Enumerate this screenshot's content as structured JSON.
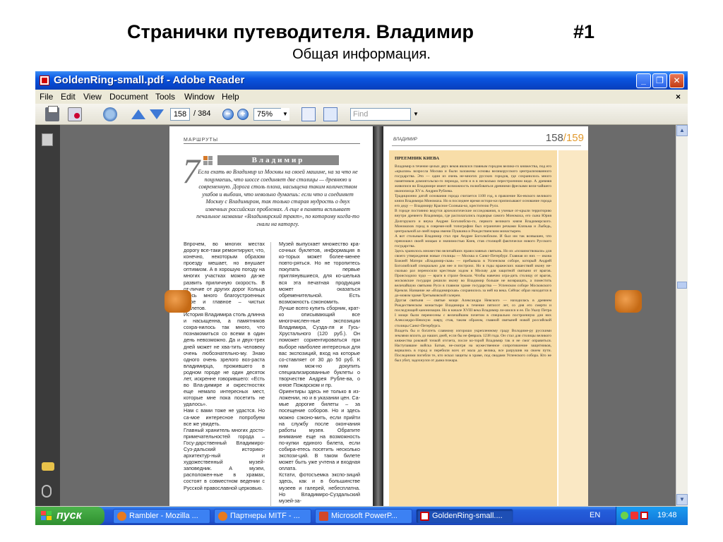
{
  "slide": {
    "title": "Странички путеводителя. Владимир",
    "number": "#1",
    "subtitle": "Общая информация."
  },
  "window": {
    "title": "GoldenRing-small.pdf - Adobe Reader",
    "menu": [
      "File",
      "Edit",
      "View",
      "Document",
      "Tools",
      "Window",
      "Help"
    ],
    "menu_close": "×"
  },
  "toolbar": {
    "page_current": "158",
    "page_total": "/ 384",
    "zoom": "75%",
    "find_placeholder": "Find"
  },
  "left_page": {
    "running_head": "МАРШРУТЫ",
    "chapter_number": "7",
    "chapter_title": "Владимир",
    "intro": "Если ехать во Владимир из Москвы на своей машине, на за что не поцумаешь, что шоссе соединяет две столицы — древнюю и современную. Дорога столь плоха, насыщена таким количеством ухабов и выбоин, что невольно думаешь: если что и соединяет Москву с Владимиром, так только старая мудрость о двух извечных российских проблемах. А еще в памяти всплывает печальное название «Владимирский тракт», по которому когда-то гнали на каторгу.",
    "col1": "Впрочем, во многих местах дорогу все-таки ремонтируют, что, конечно, некоторым образом проезду мешает, но внушает оптимизм. А в хорошую погоду на многих участках можно да-же развить приличную скорость. В от-личие от других дорог Кольца здесь много благоустроенных кафе и главное – чистых туалетов.\n  История Владимира столь длинна и насыщенна, а памятников сохра-нилось так много, что познакомиться со всеми в один день невозможно. Да и двух-трех дней может не хва-тить человеку очень любознательно-му. Знаю одного очень зрелого воз-раста владимирца, прожившего в родном городе не один десяток лет, искренне говорившего: «Есть во Вла-димире и окрестностях еще немало интересных мест, которые мне пока посетить не удалось».\n  Нам с вами тоже не удастся. Но са-мое интересное попробуем все же увидеть.\n  Главный хранитель многих досто-примечательностей города – Госу-дарственный Владимиро-Суз-дальский историко-архитектур-ный и художественный музей-заповедник. А музеи, расположен-ные в храмах, состоят в совместном ведении с Русской православной церковью.",
    "col2": "Музей выпускает множество кра-сочных буклетов, информация в ко-торых может более-менее повто-ряться. Но не торопитесь покупать первые приглянувшиеся, для ко-шелька вся эта печатная продукция может оказаться обременительной. Есть возможность сэкономить.\n  Лучше всего купить сборник, крат-ко описывающий все многочислен-ные экспозиции Владимира, Сузда-ля и Гусь-Хрустального (120 руб.). Он поможет сориентироваться при выборе наиболее интересных для вас экспозиций, вход на которые со-ставляет от 30 до 50 руб. К ним мож-но докупить специализированные буклеты о творчестве Андрея Рубле-ва, о князе Пожарском и пр.\n  Ориентиры здесь не только в из-ложении, но и в указании цен. Са-мые дорогие билеты – за посещение соборов. Но и здесь можно сэконо-мить, если прийти на службу после окончания работы музея. Обратите внимание еще на возможность по-купки единого билета, если собира-етесь посетить несколько экспози-ций. В таком билете может быть уже учтена и входная оплата.\n  Кстати, фотосъемка экспо-зиций здесь, как и в большинстве музеев и галерей, небесплатна. Но Владимиро-Суздальский музей-за-"
  },
  "right_page": {
    "running_head": "ВЛАДИМИР",
    "page_numbers": [
      "158",
      "/159"
    ],
    "box_heading": "ПРЕЕМНИК КИЕВА",
    "box_text": "Владимир в течение целых двух веков являлся главным городом велико-го княжества, под его «крылом» возросла Москва и были заложены основы великорусского централизованного государства. Это — один из очень не-многих русских городов, где сохранилось много памятников домонгольско-го периода, хотя и в в несколько перестроенном виде. А древняя живописи во Владимире имеет возможность полюбоваться древними фресками вели-чайшего иконописца XV в. Андрея Рублева.\n  Традиционно датой основания города считается 1108 год, в правление Ки-евского великого князя Владимира Мономаха. Но в последнее время истори-ки приписывают основание города его деду — Владимиру Красное Солныш-ко, крестителю Руси.\n  В городе постоянно ведутся археологические исследования, в ученые от-крыли территорию внутри древнего Владимира, где располагались подворья самого Мономаха, его сына Юрия Долгорукого и внука Андрея Боголюбско-го, первого великого князя Владимирского. Мономахов город в совремн-ной топографии был ограничен речками Клязьма и Лыбедь, центральной ал-леей парка имени Пушкина и Рождественским монастырем.\n  А вот стольным Владимир стал при Андрее Боголюбском. И был им так возвышен, что превзошел своей мощью и значимостью Киев, став столицей фактически нового Русского государства.\n  Здесь хранилось множество величайших православных святынь. Но их «позаимствовали» для своего утверждения новые столицы — Москва и Санкт-Петербург. Главная из них — икона Божией Матери «Владимир-ская» — пребывала в Успенском соборе, который Андрей Боголюбский специально для нее и построил. Но в годы вражеских нашествий икону не-сколько раз переносили крестным ходом в Москву для защитной святыни от врагов. Происходило чудо — враги в страхе бежали. Чтобы навечно огра-дить столицу от врагов, московские государи решили икону во Владимир больше не возвращать, а поместить величайшую святыню Руси в главном храме государства — Успенском соборе Московского Кремля. Название же «Владимирская» сохранилось за ней на века. Сейчас образ находится в до-мовом храме Третьяковской галереи.\n  Другая святыня — святые мощи Александра Невского — находилась в древнем Рождественском монастыре Владимира в течение пятисот лет, со дня его смерти и последующей канонизации. Но в начале XVIII века Владимир ли-шился и ее. По Указу Петра I мощи были перенесены с величайшим почетом в специально построенную для них Александро-Невскую лавру, став, таким образом, главной святыней новой российской столицы Санкт-Петербурга.\n  Владеть бы и богатеть славному изгорошо укрепленному граду Володиме-ру русскими землями вплоть до наших дней, если бы не февраль 1238 года. Он стал для столицы великого княжества роковой точкой отсчета, после ко-торой Владимир так и не смог оправиться. Наступавшие войска Батыя, не-смотря на мужественное сопротивление защитников, ворвались в город и перебили всех от мала до велика, все разрушив на своем пути. Последними погибли те, кто искал защиты в храме, под сводами Успенского собора. Кто не был убит, задохнулся от дыма пожара."
  },
  "taskbar": {
    "start": "пуск",
    "tasks": [
      {
        "label": "Rambler - Mozilla ..."
      },
      {
        "label": "Партнеры MITF - ..."
      },
      {
        "label": "Microsoft PowerP..."
      },
      {
        "label": "GoldenRing-small...."
      }
    ],
    "lang": "EN",
    "clock": "19:48"
  },
  "colors": {
    "xp_blue": "#0a55e0",
    "box_fill": "#f8dda8",
    "nav_orange": "#d57a2a",
    "page_number_accent": "#e29a2e"
  }
}
